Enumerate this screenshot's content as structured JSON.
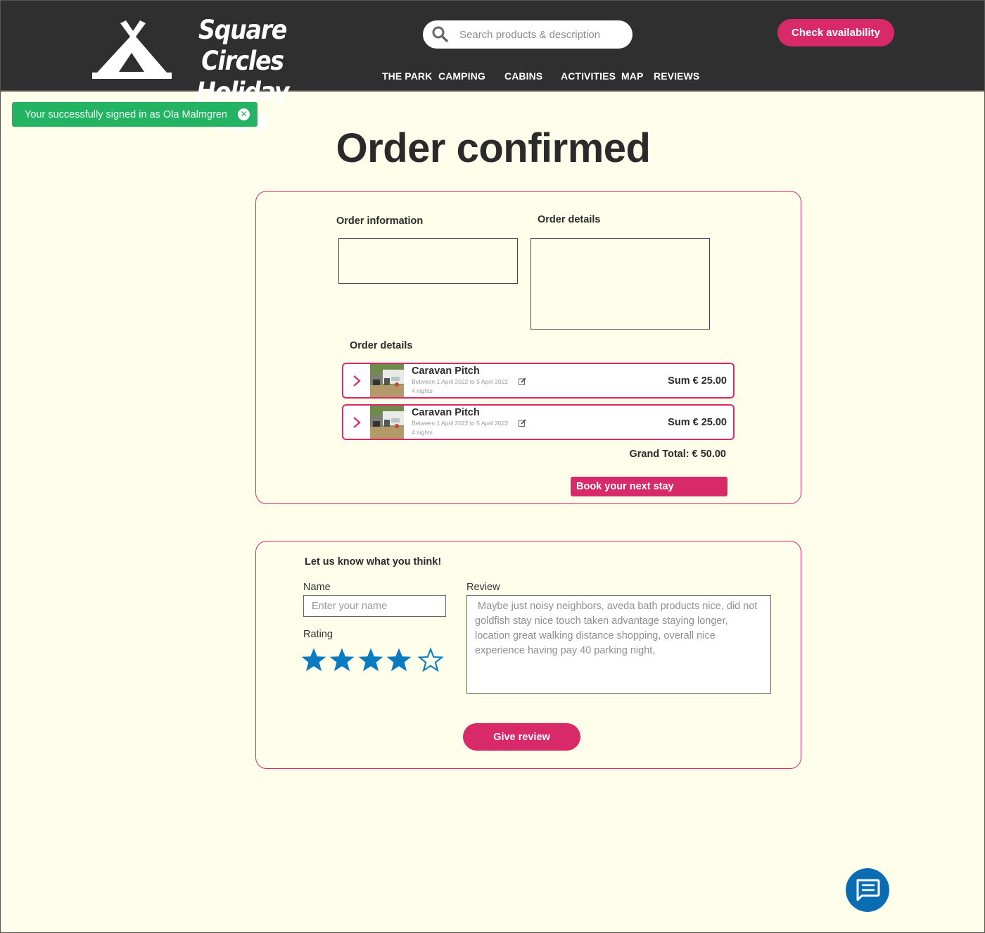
{
  "header": {
    "logo_line1": "Square Circles",
    "logo_line2": "Holiday Park",
    "search_placeholder": "Search products & description",
    "check_availability": "Check availability",
    "nav": [
      "THE PARK",
      "CAMPING",
      "CABINS",
      "ACTIVITIES",
      "MAP",
      "REVIEWS"
    ]
  },
  "toast": {
    "message": "Your successfully signed in as Ola Malmgren",
    "close_icon": "close-circle-icon"
  },
  "page_title": "Order confirmed",
  "order": {
    "info_label": "Order information",
    "details_label": "Order details",
    "list_label": "Order details",
    "items": [
      {
        "name": "Caravan Pitch",
        "dates": "Between 1 April 2022 to 5 April 2022",
        "nights": "4 nights",
        "sum": "Sum € 25.00"
      },
      {
        "name": "Caravan Pitch",
        "dates": "Between 1 April 2022 to 5 April 2022",
        "nights": "4 nights",
        "sum": "Sum € 25.00"
      }
    ],
    "grand_total": "Grand Total: € 50.00",
    "book_button": "Book your next stay"
  },
  "review": {
    "heading": "Let us know what you think!",
    "name_label": "Name",
    "name_placeholder": "Enter your name",
    "rating_label": "Rating",
    "rating": 4,
    "rating_max": 5,
    "review_label": "Review",
    "review_text": " Maybe just noisy neighbors, aveda bath products nice, did not goldfish stay nice touch taken advantage staying longer, location great walking distance shopping, overall nice experience having pay 40 parking night,",
    "submit": "Give review"
  },
  "colors": {
    "header_bg": "#2f2f30",
    "accent": "#d82a68",
    "page_bg": "#fffeeb",
    "success": "#24b263",
    "star": "#0a7bc0",
    "chat": "#0a6db4"
  }
}
